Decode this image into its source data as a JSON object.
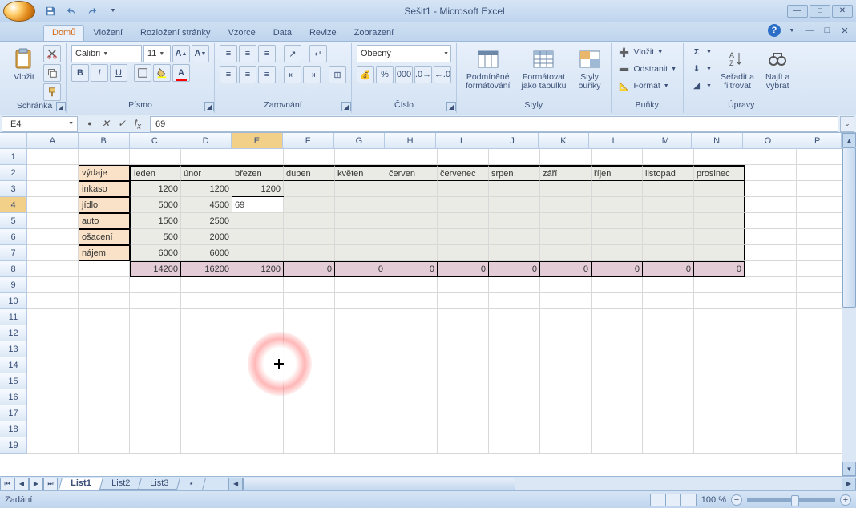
{
  "title": "Sešit1 - Microsoft Excel",
  "tabs": [
    "Domů",
    "Vložení",
    "Rozložení stránky",
    "Vzorce",
    "Data",
    "Revize",
    "Zobrazení"
  ],
  "activeTab": 0,
  "ribbon": {
    "paste": "Vložit",
    "clipboard": "Schránka",
    "font": {
      "label": "Písmo",
      "family": "Calibri",
      "size": "11"
    },
    "alignment": "Zarovnání",
    "numberFormat": "Obecný",
    "numberGroup": "Číslo",
    "styles": {
      "label": "Styly",
      "cond": "Podmíněné\nformátování",
      "table": "Formátovat\njako tabulku",
      "cells": "Styly\nbuňky"
    },
    "cells": {
      "label": "Buňky",
      "insert": "Vložit",
      "delete": "Odstranit",
      "format": "Formát"
    },
    "editing": {
      "label": "Úpravy",
      "sort": "Seřadit a\nfiltrovat",
      "find": "Najít a\nvybrat"
    }
  },
  "nameBox": "E4",
  "formula": "69",
  "columns": [
    "A",
    "B",
    "C",
    "D",
    "E",
    "F",
    "G",
    "H",
    "I",
    "J",
    "K",
    "L",
    "M",
    "N",
    "O",
    "P"
  ],
  "activeCol": 4,
  "activeRow": 4,
  "rowCount": 19,
  "data": {
    "b2": "výdaje",
    "months": [
      "leden",
      "únor",
      "březen",
      "duben",
      "květen",
      "červen",
      "červenec",
      "srpen",
      "září",
      "říjen",
      "listopad",
      "prosinec"
    ],
    "rowLabels": [
      "inkaso",
      "jídlo",
      "auto",
      "ošacení",
      "nájem"
    ],
    "vals": {
      "inkaso": [
        "1200",
        "1200",
        "1200"
      ],
      "jidlo": [
        "5000",
        "4500",
        "69"
      ],
      "auto": [
        "1500",
        "2500"
      ],
      "osaceni": [
        "500",
        "2000"
      ],
      "najem": [
        "6000",
        "6000"
      ]
    },
    "totals": [
      "14200",
      "16200",
      "1200",
      "0",
      "0",
      "0",
      "0",
      "0",
      "0",
      "0",
      "0",
      "0"
    ]
  },
  "sheets": [
    "List1",
    "List2",
    "List3"
  ],
  "activeSheet": 0,
  "status": "Zadání",
  "zoom": "100 %"
}
